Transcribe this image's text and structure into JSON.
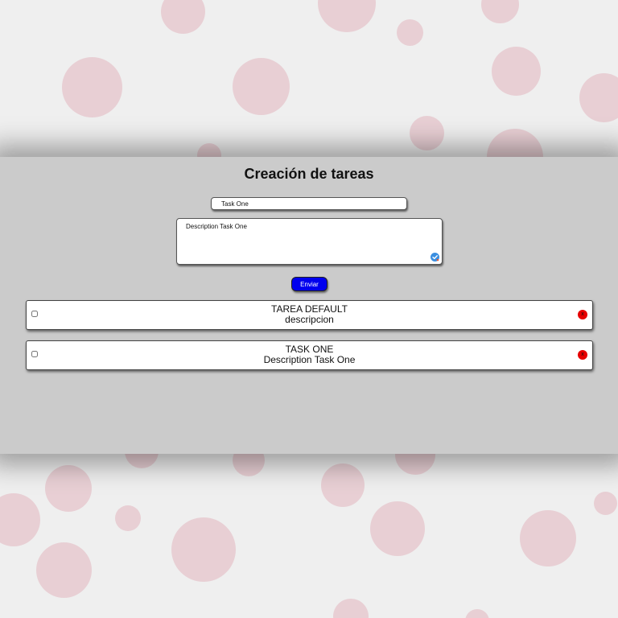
{
  "page": {
    "title": "Creación de tareas"
  },
  "form": {
    "title_value": "Task One",
    "description_value": "Description Task One",
    "submit_label": "Enviar"
  },
  "tasks": [
    {
      "title": "TAREA DEFAULT",
      "description": "descripcion",
      "checked": false,
      "delete_label": "x"
    },
    {
      "title": "TASK ONE",
      "description": "Description Task One",
      "checked": false,
      "delete_label": "x"
    }
  ],
  "colors": {
    "page_background": "#efefef",
    "dot_color": "#e8cfd4",
    "panel_background": "#cbcbcb",
    "submit_button": "#0000ee",
    "delete_button": "#e60000",
    "check_badge": "#3b8fe0"
  }
}
